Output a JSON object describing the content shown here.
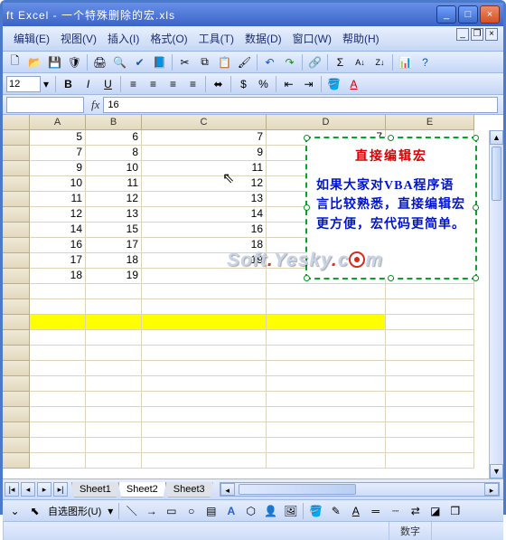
{
  "window": {
    "title": "ft Excel - 一个特殊删除的宏.xls"
  },
  "menus": [
    "编辑(E)",
    "视图(V)",
    "插入(I)",
    "格式(O)",
    "工具(T)",
    "数据(D)",
    "窗口(W)",
    "帮助(H)"
  ],
  "toolbar1_icons": [
    "new",
    "open",
    "save",
    "permission",
    "sep",
    "print",
    "preview",
    "spell",
    "research",
    "sep",
    "cut",
    "copy",
    "paste",
    "format-painter",
    "sep",
    "undo",
    "redo",
    "sep",
    "hyperlink",
    "sep",
    "autosum",
    "sort-asc",
    "sort-desc",
    "sep",
    "chart",
    "help"
  ],
  "toolbar2": {
    "font_size": "12",
    "icons": [
      "bold",
      "italic",
      "underline",
      "sep",
      "align-left",
      "align-center",
      "align-right",
      "align-justify",
      "sep",
      "merge",
      "sep",
      "currency",
      "percent",
      "sep",
      "indent-dec",
      "indent-inc",
      "sep",
      "fill-color",
      "font-color"
    ]
  },
  "namebox": "",
  "formula_value": "16",
  "columns": [
    "A",
    "B",
    "C",
    "D",
    "E"
  ],
  "rows": [
    {
      "A": "5",
      "B": "6",
      "C": "7",
      "D": "7",
      "E": ""
    },
    {
      "A": "7",
      "B": "8",
      "C": "9",
      "D": "",
      "E": ""
    },
    {
      "A": "9",
      "B": "10",
      "C": "11",
      "D": "",
      "E": ""
    },
    {
      "A": "10",
      "B": "11",
      "C": "12",
      "D": "",
      "E": ""
    },
    {
      "A": "11",
      "B": "12",
      "C": "13",
      "D": "",
      "E": ""
    },
    {
      "A": "12",
      "B": "13",
      "C": "14",
      "D": "",
      "E": ""
    },
    {
      "A": "14",
      "B": "15",
      "C": "16",
      "D": "",
      "E": ""
    },
    {
      "A": "16",
      "B": "17",
      "C": "18",
      "D": "",
      "E": ""
    },
    {
      "A": "17",
      "B": "18",
      "C": "19",
      "D": "",
      "E": ""
    },
    {
      "A": "18",
      "B": "19",
      "C": "",
      "D": "",
      "E": ""
    }
  ],
  "textbox": {
    "title": "直接编辑宏",
    "body": "如果大家对VBA程序语言比较熟悉，直接编辑宏更方便，宏代码更简单。"
  },
  "watermark": {
    "p1": "Soft",
    "p2": "Yesky",
    "p3": "c",
    "p4": "m"
  },
  "sheets": {
    "tabs": [
      "Sheet1",
      "Sheet2",
      "Sheet3"
    ],
    "active": 1
  },
  "draw_label": "自选图形(U)",
  "draw_icons": [
    "pointer",
    "autoshapes",
    "sep",
    "line",
    "arrow",
    "rect",
    "oval",
    "textbox",
    "wordart",
    "diagram",
    "clipart",
    "picture",
    "sep",
    "fill",
    "line-color",
    "font-color",
    "line-style",
    "dash",
    "arrow-style",
    "shadow",
    "3d"
  ],
  "status": {
    "mode": "数字"
  }
}
